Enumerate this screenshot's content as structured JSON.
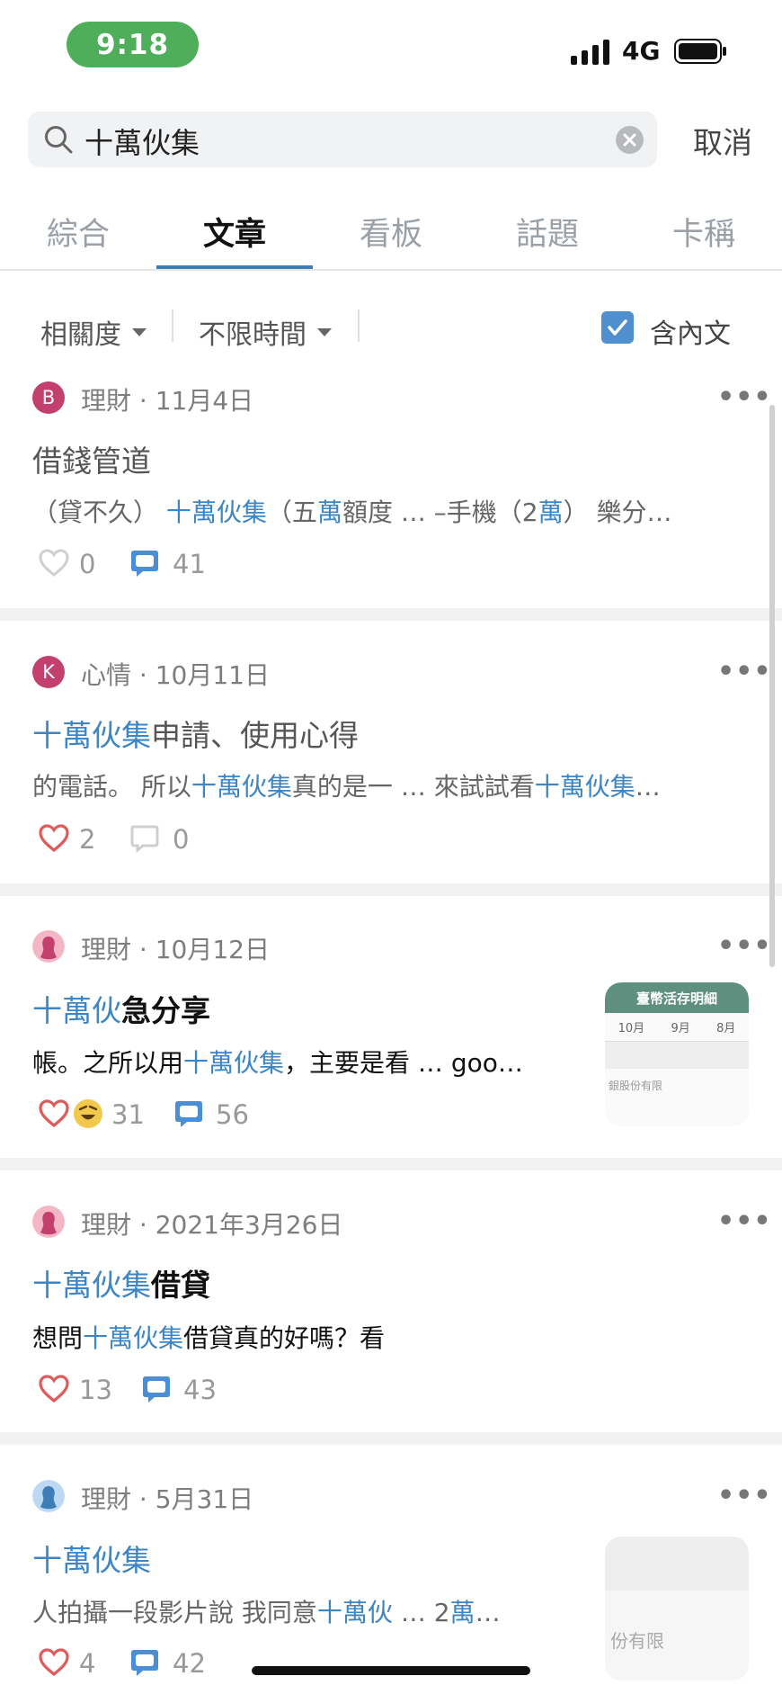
{
  "status_bar": {
    "time": "9:18",
    "network": "4G"
  },
  "search": {
    "query": "十萬伙集",
    "cancel_label": "取消"
  },
  "tabs": [
    {
      "label": "綜合",
      "active": false
    },
    {
      "label": "文章",
      "active": true
    },
    {
      "label": "看板",
      "active": false
    },
    {
      "label": "話題",
      "active": false
    },
    {
      "label": "卡稱",
      "active": false
    }
  ],
  "filters": {
    "sort": "相關度",
    "time": "不限時間",
    "include_body_label": "含內文",
    "include_body_checked": true
  },
  "posts": [
    {
      "avatar_letter": "B",
      "board": "理財",
      "sep": "·",
      "date": "11月4日",
      "title": "借錢管道",
      "snippet": [
        "（貸不久） ",
        "十萬伙集",
        "（五",
        "萬",
        "額度 … –手機（2",
        "萬",
        "） 樂分…"
      ],
      "likes": "0",
      "comments": "41"
    },
    {
      "avatar_letter": "K",
      "board": "心情",
      "sep": "·",
      "date": "10月11日",
      "title_highlight": "十萬伙集",
      "title_rest": "申請、使用心得",
      "snippet": [
        "的電話。 所以",
        "十萬伙集",
        "真的是一 … 來試試看",
        "十萬伙集",
        "…"
      ],
      "likes": "2",
      "comments": "0"
    },
    {
      "board": "理財",
      "sep": "·",
      "date": "10月12日",
      "title_highlight": "十萬伙",
      "title_rest": "急分享",
      "snippet": [
        "帳。之所以用",
        "十萬伙集",
        "，主要是看 … goo…"
      ],
      "likes": "31",
      "comments": "56",
      "thumbnail": {
        "header": "臺幣活存明細",
        "cols": [
          "10月",
          "9月",
          "8月"
        ],
        "footer": "銀股份有限"
      }
    },
    {
      "board": "理財",
      "sep": "·",
      "date": "2021年3月26日",
      "title_highlight": "十萬伙集",
      "title_rest": "借貸",
      "snippet": [
        "想問",
        "十萬伙集",
        "借貸真的好嗎？看"
      ],
      "likes": "13",
      "comments": "43"
    },
    {
      "board": "理財",
      "sep": "·",
      "date": "5月31日",
      "title_highlight": "十萬伙集",
      "snippet": [
        "人拍攝一段影片說 我同意",
        "十萬伙",
        " … 2",
        "萬",
        "…"
      ],
      "likes": "4",
      "comments": "42",
      "thumbnail": {
        "footer": "份有限"
      }
    }
  ],
  "colors": {
    "accent": "#3d86c6",
    "like_red": "#e05a5a",
    "comment_blue": "#4a8fd6",
    "avatar_pink": "#c33f6e"
  }
}
